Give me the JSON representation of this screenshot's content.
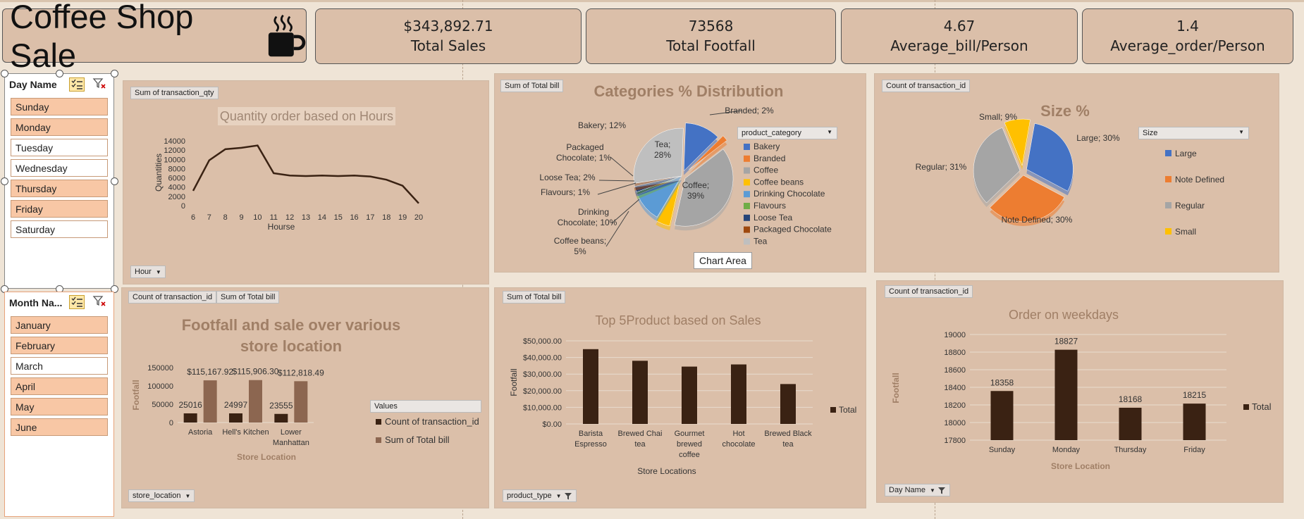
{
  "header": {
    "title": "Coffee Shop Sale",
    "icon": "coffee-cup-icon"
  },
  "kpis": [
    {
      "value": "$343,892.71",
      "label": "Total Sales"
    },
    {
      "value": "73568",
      "label": "Total Footfall"
    },
    {
      "value": "4.67",
      "label": "Average_bill/Person"
    },
    {
      "value": "1.4",
      "label": "Average_order/Person"
    }
  ],
  "slicers": {
    "day": {
      "title": "Day Name",
      "items": [
        {
          "label": "Sunday",
          "selected": true
        },
        {
          "label": "Monday",
          "selected": true
        },
        {
          "label": "Tuesday",
          "selected": false
        },
        {
          "label": "Wednesday",
          "selected": false
        },
        {
          "label": "Thursday",
          "selected": true
        },
        {
          "label": "Friday",
          "selected": true
        },
        {
          "label": "Saturday",
          "selected": false
        }
      ]
    },
    "month": {
      "title": "Month Na...",
      "items": [
        {
          "label": "January",
          "selected": true
        },
        {
          "label": "February",
          "selected": true
        },
        {
          "label": "March",
          "selected": false
        },
        {
          "label": "April",
          "selected": true
        },
        {
          "label": "May",
          "selected": true
        },
        {
          "label": "June",
          "selected": true
        }
      ]
    }
  },
  "field_buttons": {
    "hours_value": "Sum of transaction_qty",
    "hours_axis": "Hour",
    "cat_value": "Sum of Total bill",
    "cat_legend": "product_category",
    "size_value": "Count of transaction_id",
    "size_legend": "Size",
    "store_value1": "Count of transaction_id",
    "store_value2": "Sum of Total bill",
    "store_axis": "store_location",
    "store_legend_title": "Values",
    "prod_value": "Sum of Total bill",
    "prod_axis": "product_type",
    "week_value": "Count of transaction_id",
    "week_axis": "Day Name"
  },
  "tooltip": "Chart Area",
  "colors": {
    "panel": "#dbbfa9",
    "dark_series": "#3a2213",
    "brown_series": "#8c6650",
    "title_brown": "#a07f66"
  },
  "chart_data": [
    {
      "id": "hours",
      "type": "line",
      "title": "Quantity order based on Hours",
      "xlabel": "Hourse",
      "ylabel": "Quantities",
      "x": [
        "6",
        "7",
        "8",
        "9",
        "10",
        "11",
        "12",
        "13",
        "14",
        "15",
        "16",
        "17",
        "18",
        "19",
        "20"
      ],
      "values": [
        3200,
        9800,
        12200,
        12500,
        13000,
        7000,
        6500,
        6400,
        6500,
        6400,
        6500,
        6300,
        5600,
        4300,
        500
      ],
      "ylim": [
        0,
        14000
      ],
      "yticks": [
        "0",
        "2000",
        "4000",
        "6000",
        "8000",
        "10000",
        "12000",
        "14000"
      ],
      "grid": false,
      "color": "#3a2213"
    },
    {
      "id": "categories",
      "type": "pie",
      "title": "Categories % Distribution",
      "legend_title": "product_category",
      "slices": [
        {
          "name": "Bakery",
          "value": 12,
          "color": "#4472c4"
        },
        {
          "name": "Branded",
          "value": 2,
          "color": "#ed7d31"
        },
        {
          "name": "Coffee",
          "value": 39,
          "color": "#a5a5a5"
        },
        {
          "name": "Coffee beans",
          "value": 5,
          "color": "#ffc000"
        },
        {
          "name": "Drinking Chocolate",
          "value": 10,
          "color": "#5b9bd5"
        },
        {
          "name": "Flavours",
          "value": 1,
          "color": "#70ad47"
        },
        {
          "name": "Loose Tea",
          "value": 2,
          "color": "#264478"
        },
        {
          "name": "Packaged Chocolate",
          "value": 1,
          "color": "#9e480e"
        },
        {
          "name": "Tea",
          "value": 28,
          "color": "#bfbfbf"
        }
      ],
      "labels": [
        "Bakery; 12%",
        "Branded; 2%",
        "Coffee; 39%",
        "Coffee beans; 5%",
        "Drinking Chocolate; 10%",
        "Flavours; 1%",
        "Loose Tea; 2%",
        "Packaged Chocolate; 1%",
        "Tea; 28%"
      ]
    },
    {
      "id": "size",
      "type": "pie",
      "title": "Size %",
      "legend_title": "Size",
      "slices": [
        {
          "name": "Large",
          "value": 30,
          "color": "#4472c4"
        },
        {
          "name": "Note Defined",
          "value": 30,
          "color": "#ed7d31"
        },
        {
          "name": "Regular",
          "value": 31,
          "color": "#a5a5a5"
        },
        {
          "name": "Small",
          "value": 9,
          "color": "#ffc000"
        }
      ],
      "labels": [
        "Large; 30%",
        "Note Defined; 30%",
        "Regular; 31%",
        "Small; 9%"
      ]
    },
    {
      "id": "stores",
      "type": "bar",
      "title": "Footfall and sale over various store location",
      "xlabel": "Store Location",
      "ylabel": "Footfall",
      "categories": [
        "Astoria",
        "Hell's Kitchen",
        "Lower Manhattan"
      ],
      "series": [
        {
          "name": "Count of transaction_id",
          "values": [
            25016,
            24997,
            23555
          ],
          "labels": [
            "25016",
            "24997",
            "23555"
          ],
          "color": "#3a2213"
        },
        {
          "name": "Sum of Total bill",
          "values": [
            115167.92,
            115906.3,
            112818.49
          ],
          "labels": [
            "$115,167.92",
            "$115,906.30",
            "$112,818.49"
          ],
          "color": "#8c6650"
        }
      ],
      "ylim": [
        0,
        150000
      ],
      "yticks": [
        "0",
        "50000",
        "100000",
        "150000"
      ],
      "legend": "right"
    },
    {
      "id": "products",
      "type": "bar",
      "title": "Top 5Product based on Sales",
      "xlabel": "Store Locations",
      "ylabel": "Footfall",
      "categories": [
        "Barista Espresso",
        "Brewed Chai tea",
        "Gourmet brewed coffee",
        "Hot chocolate",
        "Brewed Black tea"
      ],
      "series": [
        {
          "name": "Total",
          "values": [
            45000,
            38000,
            34500,
            35800,
            24000
          ],
          "color": "#3a2213"
        }
      ],
      "ylim": [
        0,
        50000
      ],
      "yticks": [
        "$0.00",
        "$10,000.00",
        "$20,000.00",
        "$30,000.00",
        "$40,000.00",
        "$50,000.00"
      ],
      "grid": true,
      "legend": "right"
    },
    {
      "id": "weekdays",
      "type": "bar",
      "title": "Order on weekdays",
      "xlabel": "Store Location",
      "ylabel": "Footfall",
      "categories": [
        "Sunday",
        "Monday",
        "Thursday",
        "Friday"
      ],
      "series": [
        {
          "name": "Total",
          "values": [
            18358,
            18827,
            18168,
            18215
          ],
          "labels": [
            "18358",
            "18827",
            "18168",
            "18215"
          ],
          "color": "#3a2213"
        }
      ],
      "ylim": [
        17800,
        19000
      ],
      "yticks": [
        "17800",
        "18000",
        "18200",
        "18400",
        "18600",
        "18800",
        "19000"
      ],
      "grid": true,
      "legend": "right"
    }
  ]
}
